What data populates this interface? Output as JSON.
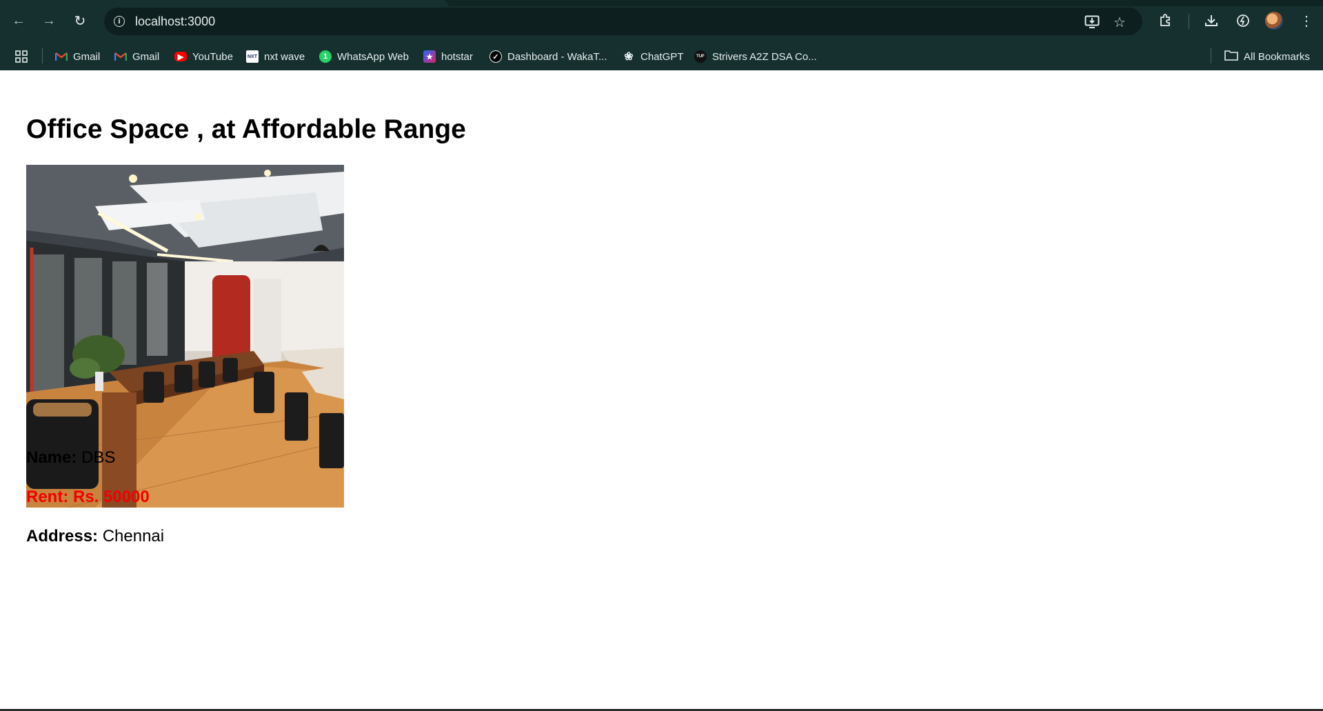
{
  "browser": {
    "url": "localhost:3000",
    "bookmarks": [
      {
        "label": "Gmail",
        "icon": "gmail-icon"
      },
      {
        "label": "Gmail",
        "icon": "gmail-icon"
      },
      {
        "label": "YouTube",
        "icon": "youtube-icon"
      },
      {
        "label": "nxt wave",
        "icon": "nxtwave-icon"
      },
      {
        "label": "WhatsApp Web",
        "icon": "whatsapp-icon"
      },
      {
        "label": "hotstar",
        "icon": "hotstar-icon"
      },
      {
        "label": "Dashboard - WakaT...",
        "icon": "wakatime-icon"
      },
      {
        "label": "ChatGPT",
        "icon": "chatgpt-icon"
      },
      {
        "label": "Strivers A2Z DSA Co...",
        "icon": "tuf-icon"
      }
    ],
    "all_bookmarks_label": "All Bookmarks"
  },
  "page": {
    "title": "Office Space , at Affordable Range",
    "name_label": "Name:",
    "name_value": "DBS",
    "rent_label": "Rent:",
    "rent_value": "Rs. 50000",
    "address_label": "Address:",
    "address_value": "Chennai"
  },
  "colors": {
    "chrome_bg": "#16302f",
    "rent_color": "#f20000"
  }
}
